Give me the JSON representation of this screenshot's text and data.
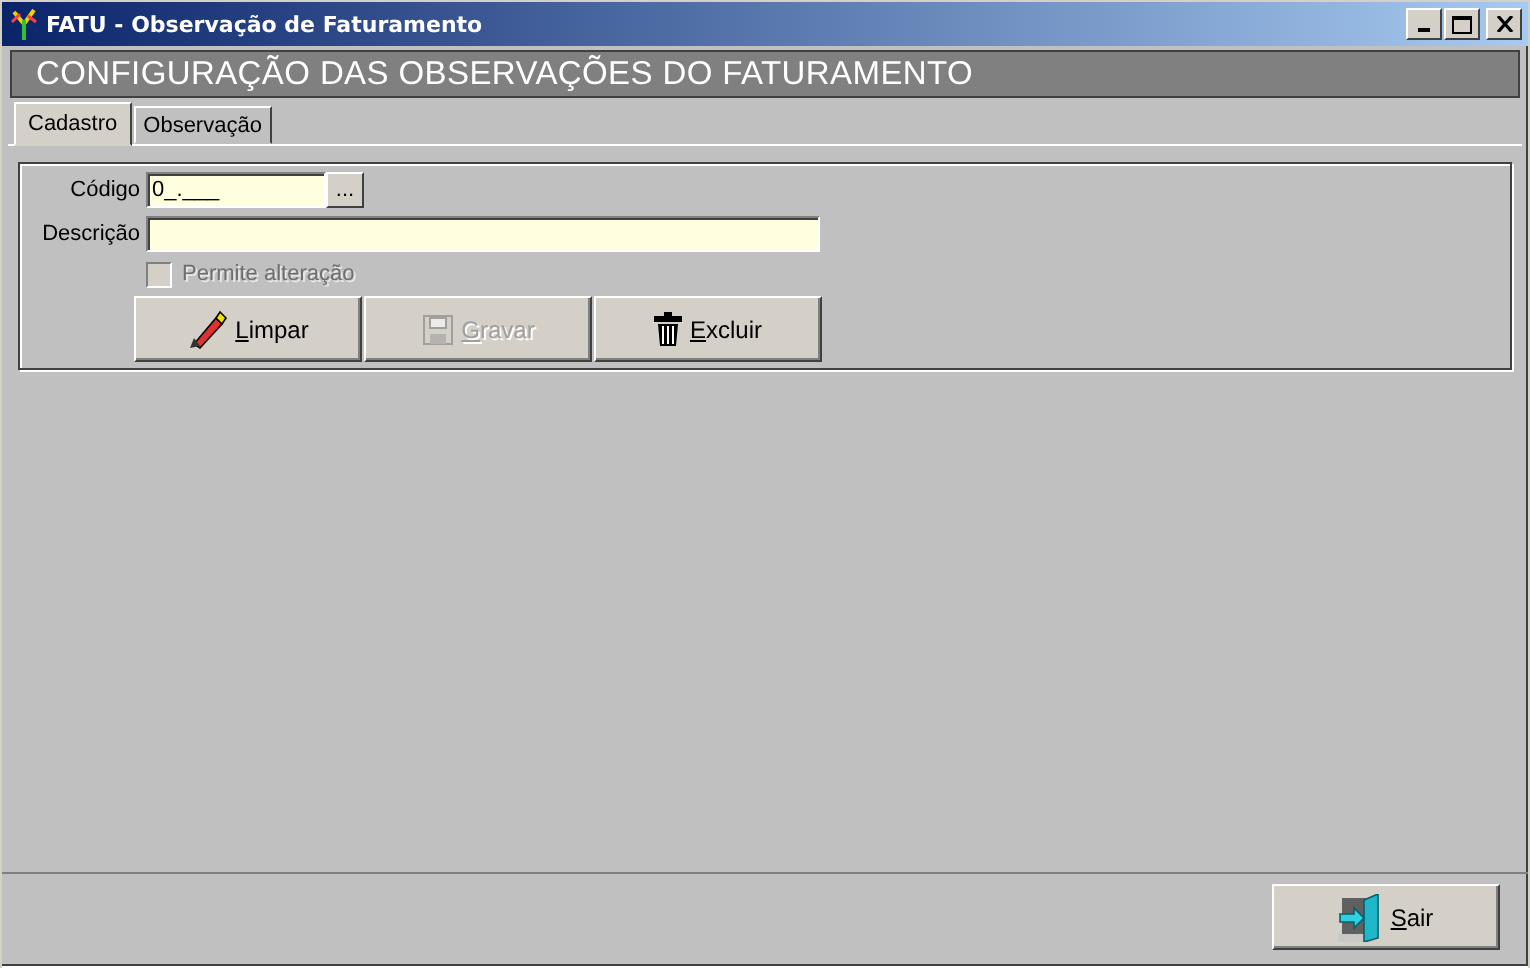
{
  "window": {
    "title": "FATU - Observação de Faturamento"
  },
  "header": {
    "title": "CONFIGURAÇÃO DAS OBSERVAÇÕES DO FATURAMENTO"
  },
  "tabs": [
    {
      "label": "Cadastro",
      "selected": true
    },
    {
      "label": "Observação",
      "selected": false
    }
  ],
  "form": {
    "codigo": {
      "label": "Código",
      "value": "0_.___",
      "lookup_button": "..."
    },
    "descricao": {
      "label": "Descrição"
    },
    "permite_alteracao": {
      "label": "Permite alteração",
      "checked": false,
      "disabled": true
    }
  },
  "buttons": [
    {
      "label": "Limpar",
      "kind": "clear",
      "disabled": false
    },
    {
      "label": "Gravar",
      "kind": "save",
      "disabled": true
    },
    {
      "label": "Excluir",
      "kind": "delete",
      "disabled": false
    }
  ],
  "footer_buttons": [
    {
      "label": "Sair",
      "kind": "exit",
      "disabled": false
    }
  ]
}
